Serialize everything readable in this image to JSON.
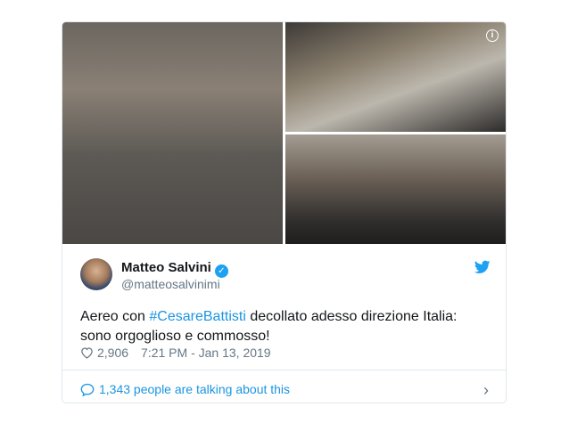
{
  "tweet": {
    "author_name": "Matteo Salvini",
    "handle": "@matteosalvinimi",
    "text_before": "Aereo con ",
    "hashtag": "#CesareBattisti",
    "text_after": " decollato adesso direzione Italia: sono orgoglioso e commosso!",
    "likes": "2,906",
    "timestamp": "7:21 PM - Jan 13, 2019",
    "talking": "1,343 people are talking about this"
  },
  "icons": {
    "info": "info-icon",
    "verified": "verified-badge-icon",
    "twitter": "twitter-bird-icon",
    "heart": "heart-icon",
    "comment": "comment-bubble-icon",
    "chevron": "chevron-right-icon"
  },
  "colors": {
    "link": "#1b95e0",
    "verified": "#1da1f2",
    "muted": "#657786",
    "border": "#e1e8ed"
  }
}
